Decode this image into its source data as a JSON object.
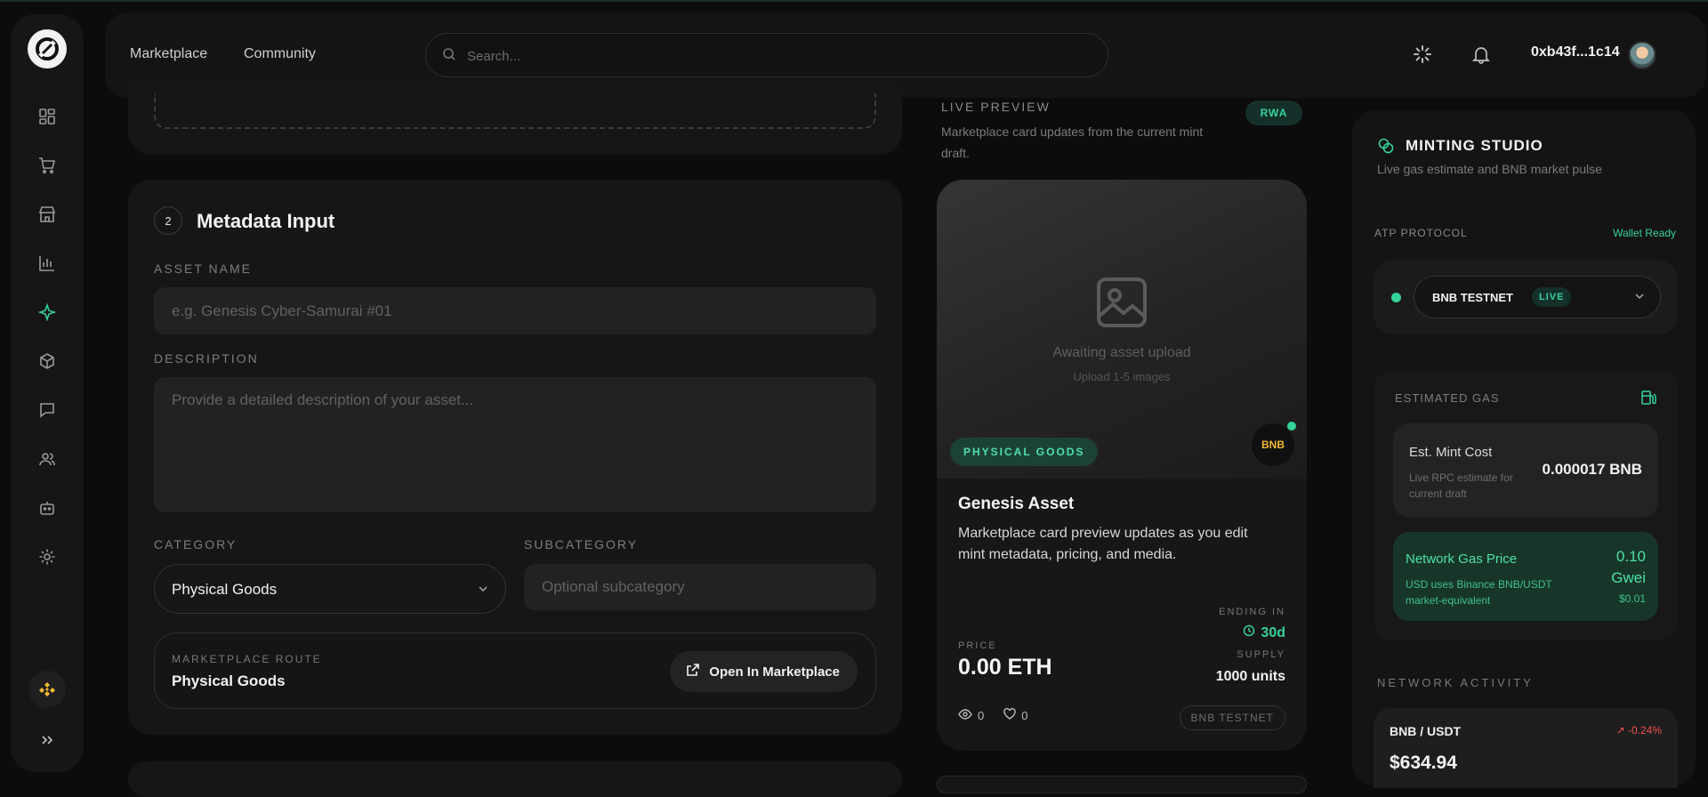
{
  "nav": {
    "marketplace": "Marketplace",
    "community": "Community"
  },
  "search": {
    "placeholder": "Search..."
  },
  "wallet": {
    "address": "0xb43f...1c14"
  },
  "form": {
    "step": "2",
    "title": "Metadata Input",
    "asset_name_label": "ASSET NAME",
    "asset_name_placeholder": "e.g. Genesis Cyber-Samurai #01",
    "description_label": "DESCRIPTION",
    "description_placeholder": "Provide a detailed description of your asset...",
    "category_label": "CATEGORY",
    "category_value": "Physical Goods",
    "subcategory_label": "SUBCATEGORY",
    "subcategory_placeholder": "Optional subcategory",
    "route_label": "MARKETPLACE ROUTE",
    "route_value": "Physical Goods",
    "route_button": "Open In Marketplace"
  },
  "preview": {
    "title": "LIVE PREVIEW",
    "subtitle": "Marketplace card updates from the current mint draft.",
    "tag": "RWA",
    "awaiting": "Awaiting asset upload",
    "upload_hint": "Upload 1-5 images",
    "category_badge": "PHYSICAL GOODS",
    "chain_badge": "BNB",
    "asset_name": "Genesis Asset",
    "asset_desc": "Marketplace card preview updates as you edit mint metadata, pricing, and media.",
    "ending_label": "ENDING IN",
    "ending_value": "30d",
    "price_label": "PRICE",
    "price_value": "0.00 ETH",
    "supply_label": "SUPPLY",
    "supply_value": "1000 units",
    "views": "0",
    "likes": "0",
    "network_pill": "BNB TESTNET"
  },
  "studio": {
    "title": "MINTING STUDIO",
    "subtitle": "Live gas estimate and BNB market pulse",
    "protocol_label": "ATP PROTOCOL",
    "wallet_status": "Wallet Ready",
    "network_name": "BNB TESTNET",
    "network_status": "LIVE",
    "gas_label": "ESTIMATED GAS",
    "mint_cost_title": "Est. Mint Cost",
    "mint_cost_sub": "Live RPC estimate for current draft",
    "mint_cost_value": "0.000017 BNB",
    "gas_price_title": "Network Gas Price",
    "gas_price_sub": "USD uses Binance BNB/USDT market-equivalent",
    "gas_price_value": "0.10 Gwei",
    "gas_price_usd": "$0.01",
    "activity_label": "NETWORK ACTIVITY",
    "pair": "BNB / USDT",
    "pair_change": "-0.24%",
    "pair_price": "$634.94"
  },
  "colors": {
    "accent": "#34d399",
    "background": "#0c0c0c",
    "card": "#161616",
    "negative": "#f0504e",
    "bnb": "#f3b930"
  },
  "icons": [
    "dashboard-icon",
    "cart-icon",
    "store-icon",
    "chart-icon",
    "sparkle-icon",
    "cube-icon",
    "chat-icon",
    "users-icon",
    "bot-icon",
    "gear-icon",
    "bnb-icon",
    "expand-icon",
    "search-icon",
    "loader-icon",
    "bell-icon"
  ]
}
